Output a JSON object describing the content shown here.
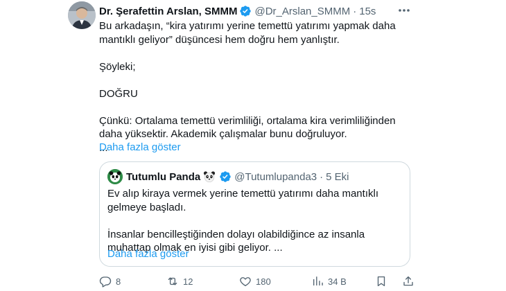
{
  "tweet": {
    "author_name": "Dr. Şerafettin Arslan, SMMM",
    "handle": "@Dr_Arslan_SMMM",
    "separator": "·",
    "time": "15s",
    "paragraphs": [
      "Bu arkadaşın, “kira yatırımı yerine temettü yatırımı yapmak daha mantıklı geliyor” düşüncesi hem doğru hem yanlıştır.",
      "Şöyleki;",
      "DOĞRU",
      "Çünkü: Ortalama temettü verimliliği, ortalama kira verimliliğinden daha yüksektir. Akademik çalışmalar bunu doğruluyor.",
      "..."
    ],
    "show_more": "Daha fazla göster"
  },
  "quote": {
    "author_name": "Tutumlu Panda",
    "handle": "@Tutumlupanda3",
    "separator": "·",
    "time": "5 Eki",
    "paragraphs": [
      "Ev alıp kiraya vermek yerine temettü yatırımı daha mantıklı gelmeye başladı.",
      "İnsanlar bencilleştiğinden dolayı olabildiğince az insanla muhattap olmak en iyisi gibi geliyor. ..."
    ],
    "show_more": "Daha fazla göster"
  },
  "actions": {
    "replies": "8",
    "retweets": "12",
    "likes": "180",
    "views": "34 B"
  },
  "colors": {
    "text": "#0f1419",
    "secondary": "#536471",
    "link": "#1d9bf0",
    "verified": "#1d9bf0",
    "border": "#cfd9de"
  },
  "icons": [
    "verified-badge-icon",
    "more-options-icon",
    "panda-emoji-icon",
    "reply-icon",
    "retweet-icon",
    "like-icon",
    "views-icon",
    "bookmark-icon",
    "share-icon"
  ]
}
